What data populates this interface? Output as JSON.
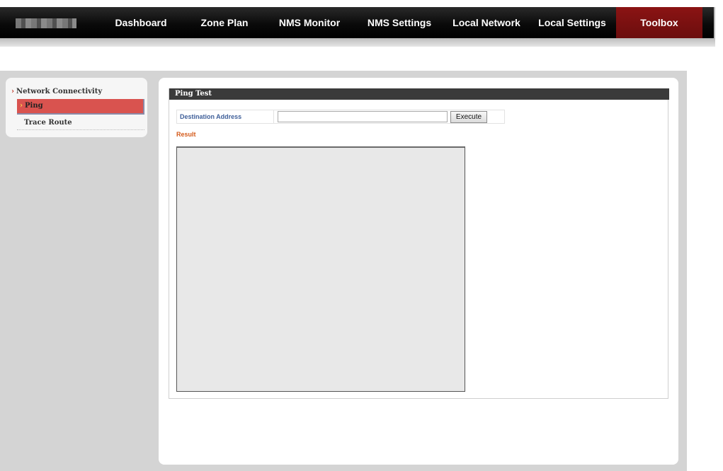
{
  "nav": {
    "items": [
      {
        "label": "Dashboard"
      },
      {
        "label": "Zone Plan"
      },
      {
        "label": "NMS Monitor"
      },
      {
        "label": "NMS Settings"
      },
      {
        "label": "Local Network"
      },
      {
        "label": "Local Settings"
      },
      {
        "label": "Toolbox",
        "active": true
      }
    ]
  },
  "sidebar": {
    "section": "Network Connectivity",
    "items": [
      {
        "label": "Ping",
        "active": true
      },
      {
        "label": "Trace Route"
      }
    ]
  },
  "ping": {
    "title": "Ping Test",
    "dest_label": "Destination Address",
    "dest_value": "",
    "execute_label": "Execute",
    "result_label": "Result",
    "result_value": ""
  },
  "colors": {
    "active_tab": "#7a1010",
    "sidebar_active": "#d9534f",
    "label_blue": "#3f5f99",
    "result_orange": "#d45a1a"
  }
}
